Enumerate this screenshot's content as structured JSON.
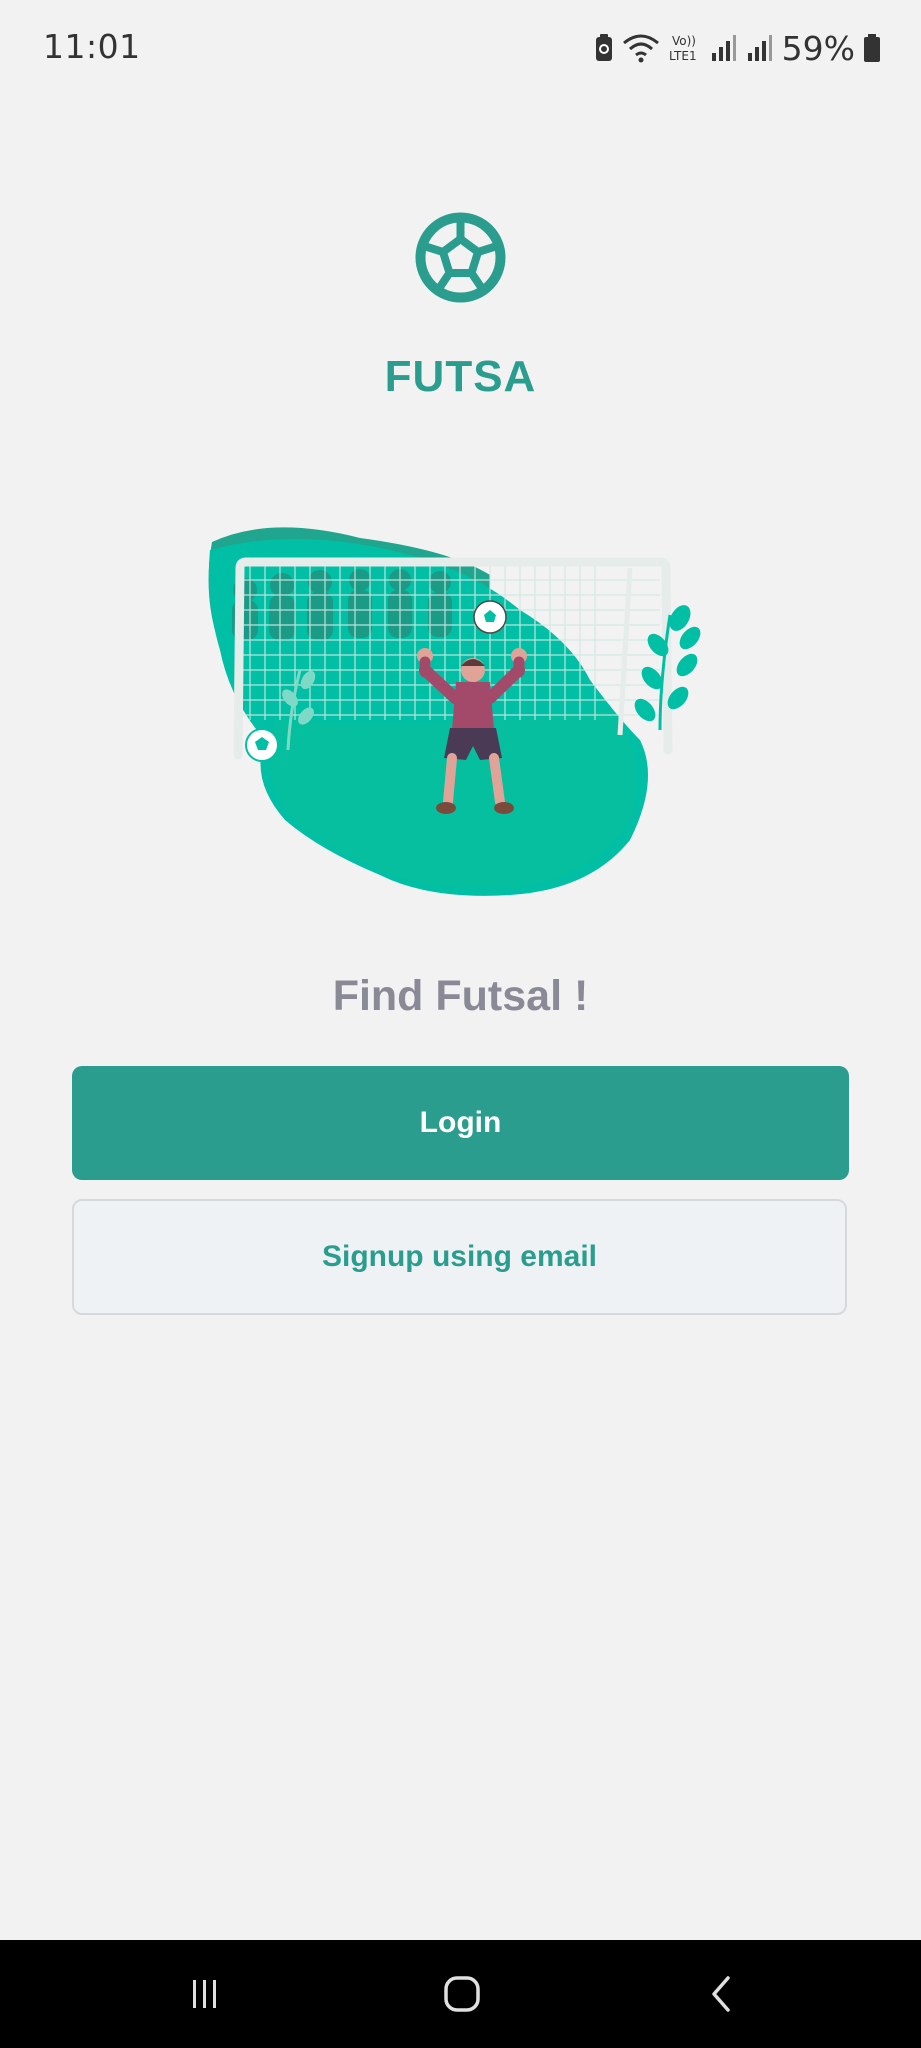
{
  "status_bar": {
    "time": "11:01",
    "battery_percent": "59%",
    "icons": [
      "battery-saver-icon",
      "wifi-icon",
      "volte-icon",
      "signal-icon",
      "signal-icon",
      "battery-icon"
    ]
  },
  "app": {
    "logo_icon": "soccer-ball-icon",
    "name": "FUTSA",
    "accent_color": "#2a9d8f"
  },
  "hero": {
    "illustration": "goalkeeper-illustration"
  },
  "main": {
    "tagline": "Find Futsal !",
    "login_label": "Login",
    "signup_label": "Signup using email"
  },
  "nav_bar": {
    "icons": [
      "recent-apps-icon",
      "home-icon",
      "back-icon"
    ]
  }
}
